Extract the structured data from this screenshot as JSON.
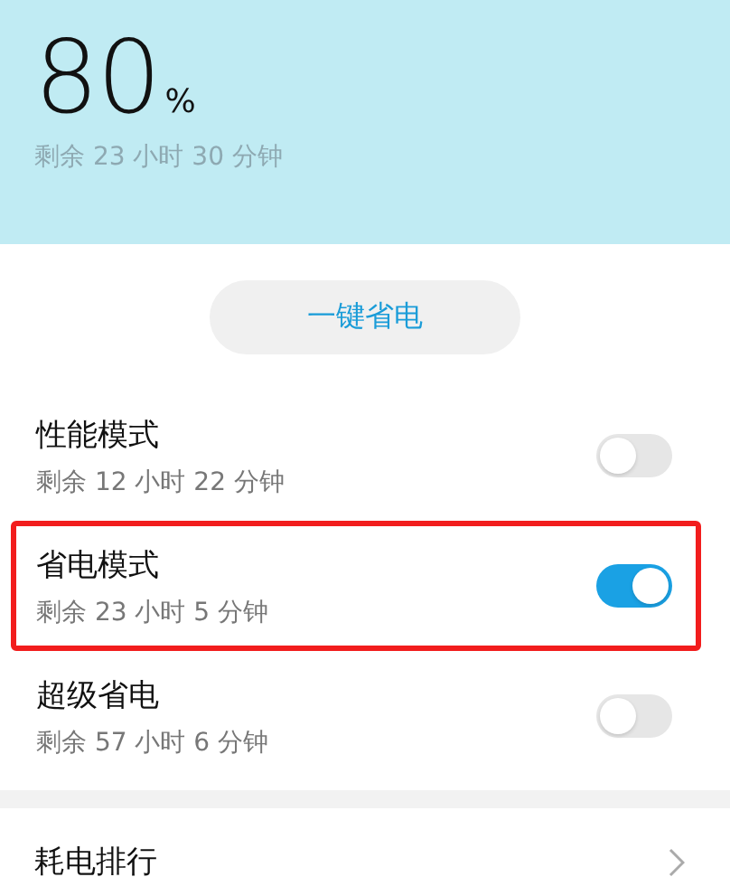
{
  "battery": {
    "percent": "80",
    "unit": "%",
    "remaining": "剩余 23 小时 30 分钟"
  },
  "one_tap_button": {
    "label": "一键省电"
  },
  "modes": [
    {
      "title": "性能模式",
      "remaining": "剩余 12 小时 22 分钟",
      "on": false,
      "highlighted": false
    },
    {
      "title": "省电模式",
      "remaining": "剩余 23 小时 5 分钟",
      "on": true,
      "highlighted": true
    },
    {
      "title": "超级省电",
      "remaining": "剩余 57 小时 6 分钟",
      "on": false,
      "highlighted": false
    }
  ],
  "menu_item": {
    "label": "耗电排行"
  }
}
